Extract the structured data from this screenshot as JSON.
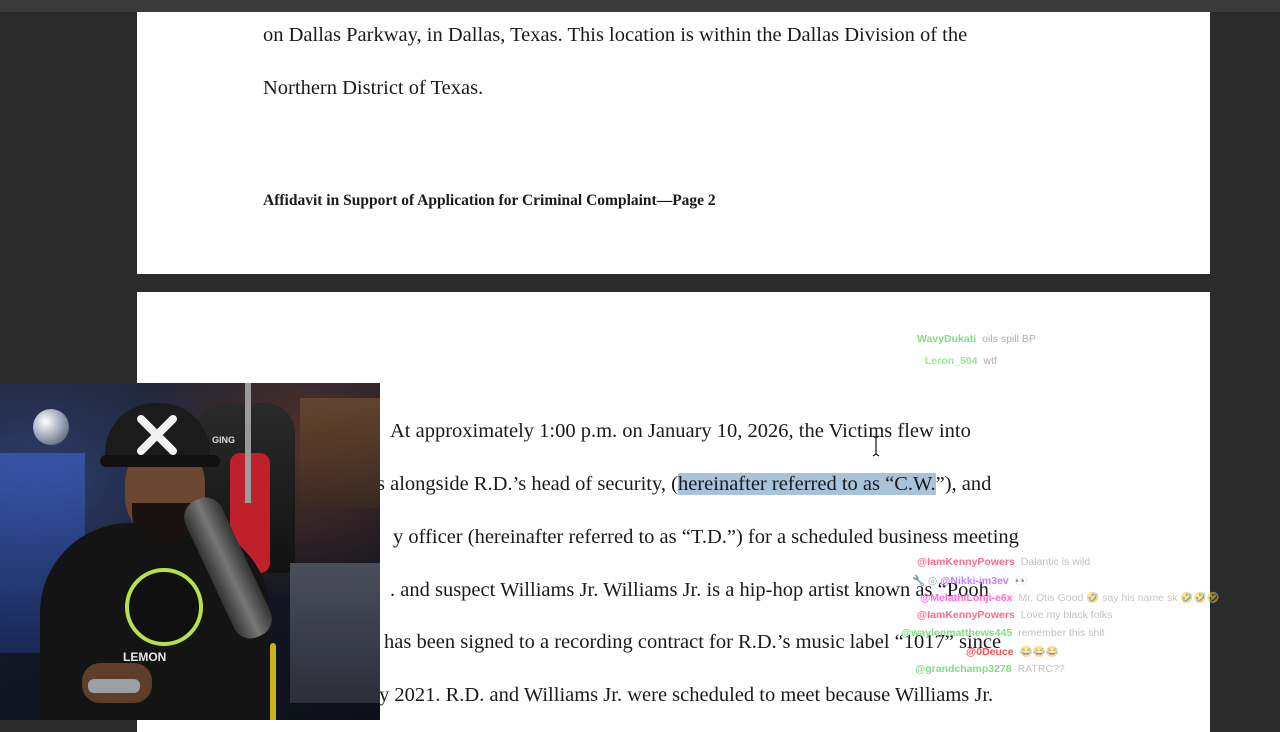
{
  "document": {
    "page1": {
      "lines": [
        "on Dallas Parkway, in Dallas, Texas. This location is within the Dallas Division of the",
        "Northern District of Texas."
      ],
      "footer": "Affidavit in Support of Application for Criminal Complaint—Page 2"
    },
    "page2": {
      "line1": "At approximately 1:00 p.m. on January 10, 2026, the Victims flew into",
      "line2_pre": "s alongside R.D.’s head of security, (",
      "line2_highlight": "hereinafter referred to as “C.W.",
      "line2_post": "”), and",
      "line3": "y officer (hereinafter referred to as “T.D.”) for a scheduled business meeting",
      "line4": ". and suspect Williams Jr. Williams Jr. is a hip-hop artist known as “Pooh",
      "line5": "has been signed to a recording contract for R.D.’s music label “1017” since",
      "line6": "y 2021. R.D. and Williams Jr. were scheduled to meet because Williams Jr."
    }
  },
  "chat_top": [
    {
      "user": "WavyDukati",
      "message": "oils spill BP",
      "color": "#7de07d"
    },
    {
      "user": "Leron_504",
      "message": "wtf",
      "color": "#7de07d"
    }
  ],
  "chat_bottom": [
    {
      "user": "@IamKennyPowers",
      "message": "Dalantic is wild",
      "color": "#ff6b8a",
      "badge": ""
    },
    {
      "user": "@Nikki-im3ev",
      "message": "👀",
      "color": "#c77dff",
      "badge": "🔧 ◎"
    },
    {
      "user": "@MelathiLonji-e6x",
      "message": "Mr. Otis Good 🤣 say his name sk 🤣🤣🤣",
      "color": "#ff6bd6",
      "badge": ""
    },
    {
      "user": "@IamKennyPowers",
      "message": "Love my black folks",
      "color": "#ff6b8a",
      "badge": ""
    },
    {
      "user": "@waylenmatthews445",
      "message": "remember this shit",
      "color": "#7de07d",
      "badge": ""
    },
    {
      "user": "@0Deuce",
      "message": "😂😂😂",
      "color": "#ff4d4d",
      "badge": ""
    },
    {
      "user": "@grandchamp3278",
      "message": "RATRC??",
      "color": "#7de07d",
      "badge": ""
    }
  ],
  "webcam": {
    "hoodie_text": "LEMON",
    "chair_text": "GING"
  },
  "colors": {
    "highlight": "#a9c3da",
    "background": "#2b2b2b"
  }
}
